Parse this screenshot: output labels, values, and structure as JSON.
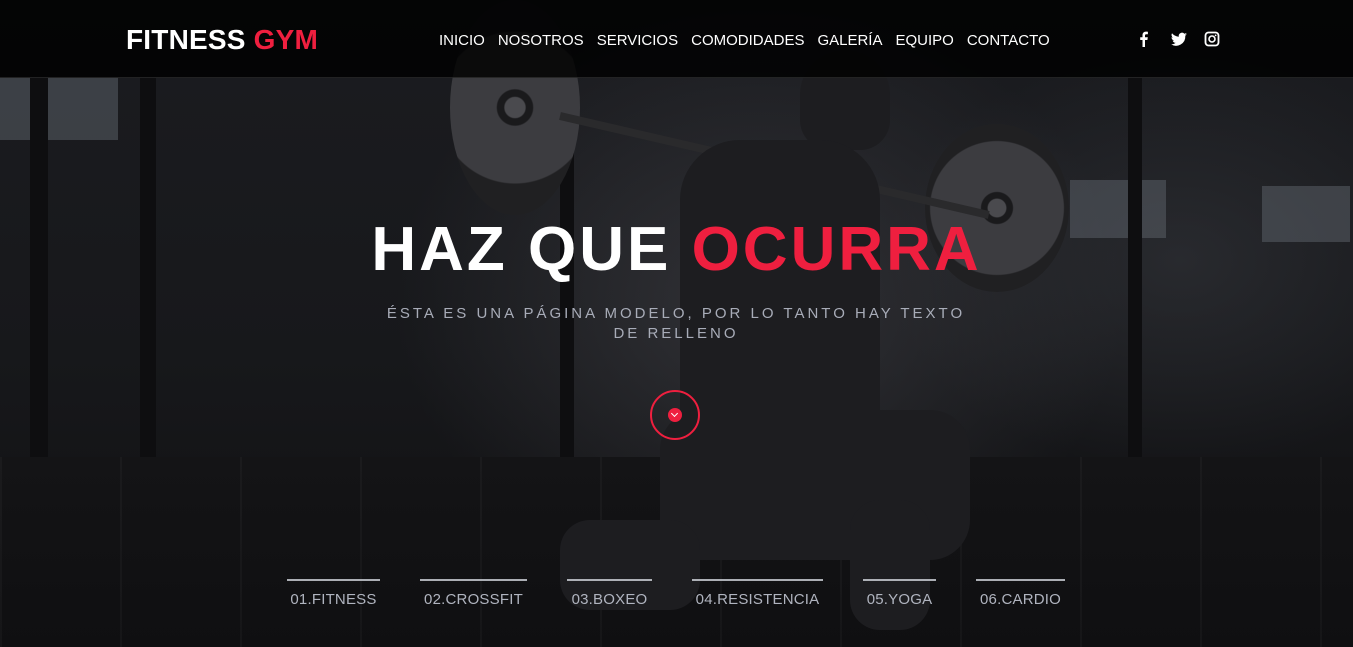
{
  "brand": {
    "name_part1": "FITNESS",
    "name_part2": "GYM"
  },
  "nav": {
    "items": [
      "INICIO",
      "NOSOTROS",
      "SERVICIOS",
      "COMODIDADES",
      "GALERÍA",
      "EQUIPO",
      "CONTACTO"
    ]
  },
  "social": {
    "icons": [
      "facebook-icon",
      "twitter-icon",
      "instagram-icon"
    ]
  },
  "hero": {
    "headline_white": "HAZ QUE",
    "headline_red": "OCURRA",
    "subtitle": "ÉSTA ES UNA PÁGINA MODELO, POR LO TANTO HAY TEXTO DE RELLENO"
  },
  "categories": [
    "01.FITNESS",
    "02.CROSSFIT",
    "03.BOXEO",
    "04.RESISTENCIA",
    "05.YOGA",
    "06.CARDIO"
  ],
  "colors": {
    "accent": "#ef1f3f",
    "text": "#ffffff",
    "muted": "#a8acb8",
    "header_bg": "#000000"
  }
}
